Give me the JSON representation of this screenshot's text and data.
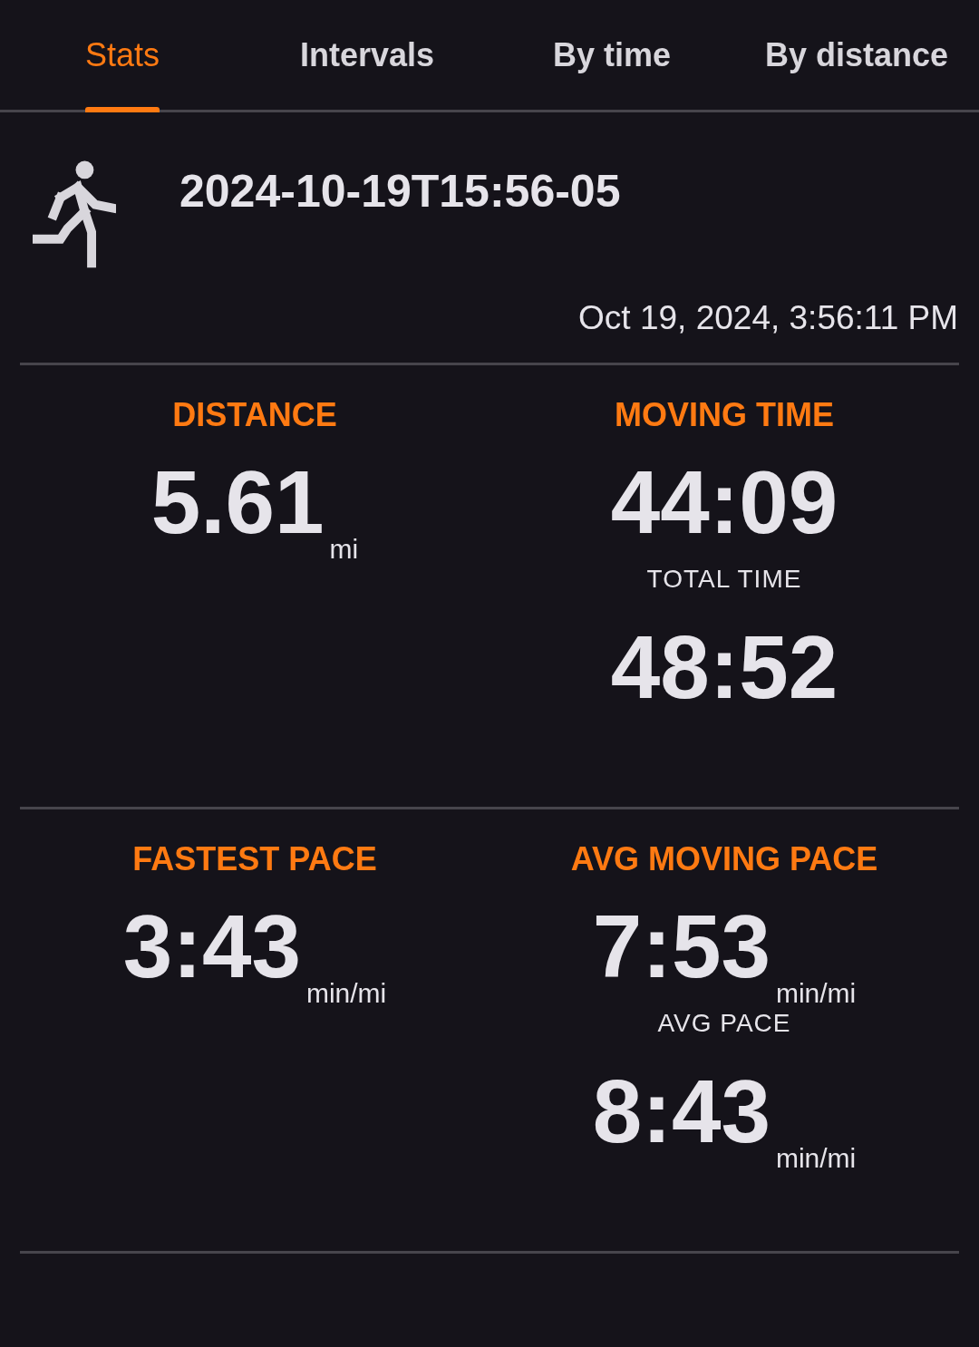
{
  "tabs": [
    {
      "label": "Stats",
      "selected": true
    },
    {
      "label": "Intervals",
      "selected": false
    },
    {
      "label": "By time",
      "selected": false
    },
    {
      "label": "By distance",
      "selected": false
    }
  ],
  "activity": {
    "title": "2024-10-19T15:56-05",
    "datetime": "Oct 19, 2024, 3:56:11 PM"
  },
  "stat_sections": [
    {
      "stats": [
        {
          "label": "DISTANCE",
          "value": "5.61",
          "unit": "mi"
        },
        {
          "label": "MOVING TIME",
          "value": "44:09",
          "sub": {
            "label": "TOTAL TIME",
            "value": "48:52"
          }
        }
      ]
    },
    {
      "stats": [
        {
          "label": "FASTEST PACE",
          "value": "3:43",
          "unit": "min/mi"
        },
        {
          "label": "AVG MOVING PACE",
          "value": "7:53",
          "unit": "min/mi",
          "sub": {
            "label": "AVG PACE",
            "value": "8:43",
            "unit": "min/mi"
          }
        }
      ]
    }
  ]
}
